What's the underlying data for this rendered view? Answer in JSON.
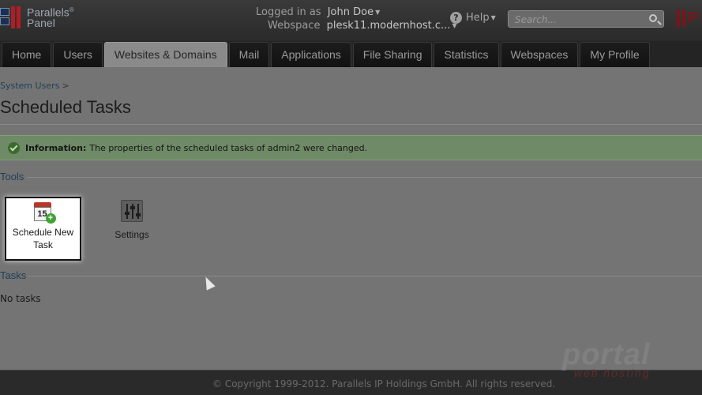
{
  "header": {
    "logo_line1": "Parallels",
    "logo_line1_mark": "®",
    "logo_line2": "Panel",
    "logged_in_label": "Logged in as",
    "user_name": "John Doe",
    "webspace_label": "Webspace",
    "webspace_value": "plesk11.modernhost.c...",
    "help_label": "Help",
    "search_placeholder": "Search...",
    "brand_letter": "P"
  },
  "nav": {
    "tabs": [
      {
        "label": "Home"
      },
      {
        "label": "Users"
      },
      {
        "label": "Websites & Domains"
      },
      {
        "label": "Mail"
      },
      {
        "label": "Applications"
      },
      {
        "label": "File Sharing"
      },
      {
        "label": "Statistics"
      },
      {
        "label": "Webspaces"
      },
      {
        "label": "My Profile"
      }
    ],
    "active_tab": "Websites & Domains"
  },
  "content": {
    "breadcrumb": "System Users",
    "breadcrumb_sep": ">",
    "title": "Scheduled Tasks",
    "message_label": "Information:",
    "message_text": "The properties of the scheduled tasks of admin2 were changed.",
    "tools_title": "Tools",
    "tools": [
      {
        "label": "Schedule New Task",
        "icon": "calendar-add-icon",
        "calendar_day": "15"
      },
      {
        "label": "Settings",
        "icon": "sliders-icon"
      }
    ],
    "tasks_title": "Tasks",
    "tasks_empty": "No tasks"
  },
  "footer": {
    "copyright": "© Copyright 1999-2012. Parallels IP Holdings GmbH. All rights reserved."
  },
  "watermark": {
    "line1": "portal",
    "line2": "web hosting"
  },
  "colors": {
    "header_bg": "#2a2a2a",
    "brand_red": "#b21d24",
    "active_tab_bg": "#8a8a8a",
    "info_bar_bg": "#6f8a66",
    "section_title": "#1e3d55"
  }
}
